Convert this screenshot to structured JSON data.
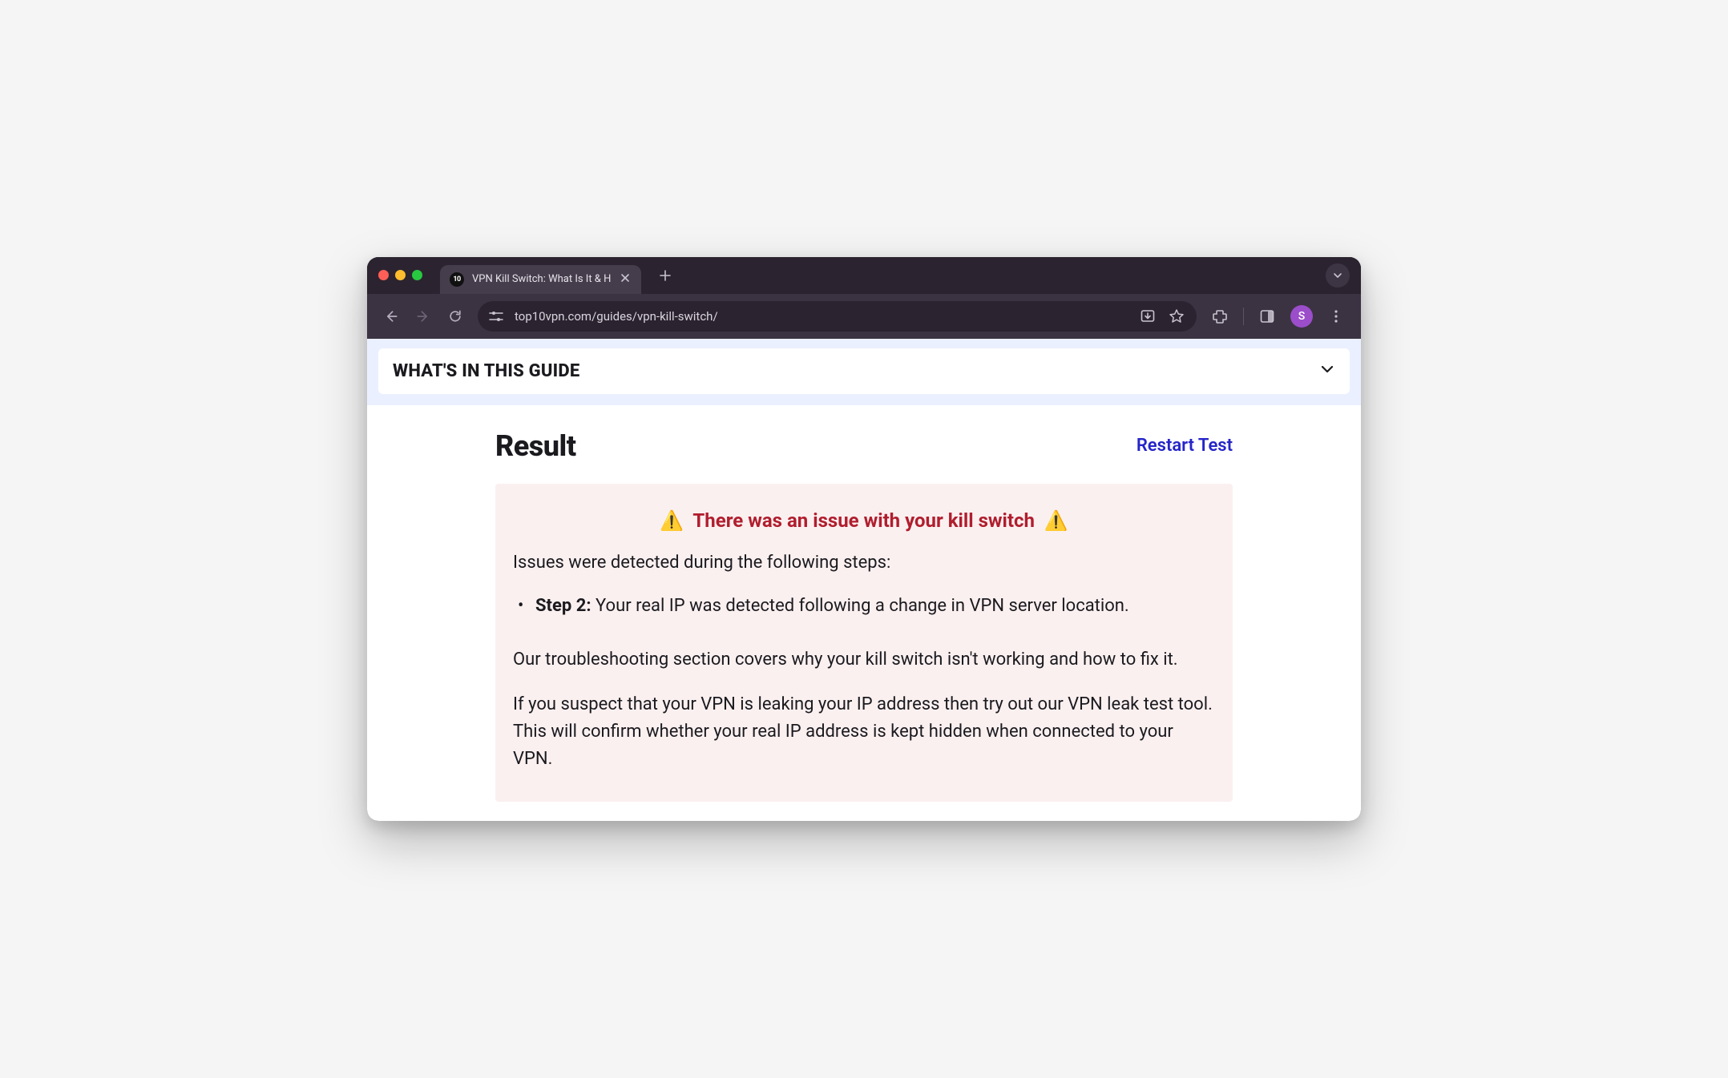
{
  "browser": {
    "tab": {
      "favicon_text": "10",
      "title": "VPN Kill Switch: What Is It & H"
    },
    "url": "top10vpn.com/guides/vpn-kill-switch/",
    "avatar_initial": "S"
  },
  "guide_banner": {
    "title": "WHAT'S IN THIS GUIDE"
  },
  "result": {
    "heading": "Result",
    "restart_label": "Restart Test",
    "warning_text": "There was an issue with your kill switch",
    "issues_intro": "Issues were detected during the following steps:",
    "issues": [
      {
        "step_label": "Step 2:",
        "text": " Your real IP was detected following a change in VPN server location."
      }
    ],
    "para1": "Our troubleshooting section covers why your kill switch isn't working and how to fix it.",
    "para2": "If you suspect that your VPN is leaking your IP address then try out our VPN leak test tool. This will confirm whether your real IP address is kept hidden when connected to your VPN."
  }
}
